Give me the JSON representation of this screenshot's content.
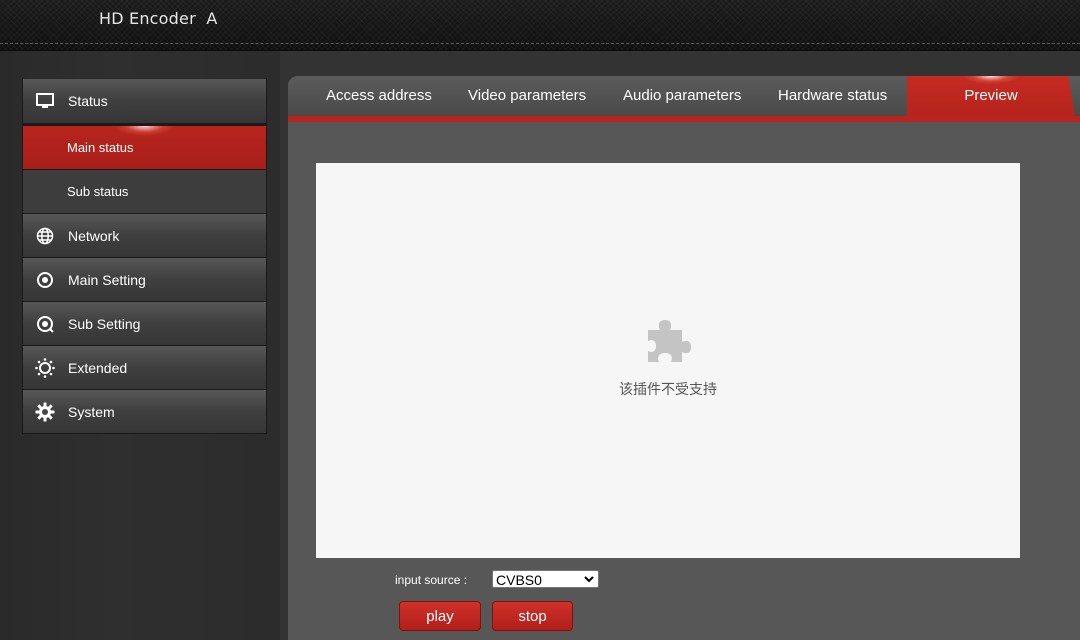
{
  "header": {
    "title": "HD Encoder  A"
  },
  "sidebar": {
    "items": [
      {
        "label": "Status",
        "icon": "monitor-icon"
      },
      {
        "label": "Network",
        "icon": "globe-icon"
      },
      {
        "label": "Main Setting",
        "icon": "target-icon"
      },
      {
        "label": "Sub Setting",
        "icon": "target-icon"
      },
      {
        "label": "Extended",
        "icon": "sun-icon"
      },
      {
        "label": "System",
        "icon": "gear-icon"
      }
    ],
    "status_sub": [
      {
        "label": "Main status",
        "active": true
      },
      {
        "label": "Sub status",
        "active": false
      }
    ]
  },
  "tabs": [
    {
      "label": "Access address"
    },
    {
      "label": "Video parameters"
    },
    {
      "label": "Audio parameters"
    },
    {
      "label": "Hardware status"
    },
    {
      "label": "Preview",
      "active": true
    }
  ],
  "plugin": {
    "message": "该插件不受支持",
    "icon": "puzzle-icon"
  },
  "controls": {
    "input_source_label": "input source :",
    "input_source_value": "CVBS0",
    "play_label": "play",
    "stop_label": "stop"
  },
  "colors": {
    "accent": "#b8251f",
    "panel": "#575757",
    "background": "#333333"
  }
}
